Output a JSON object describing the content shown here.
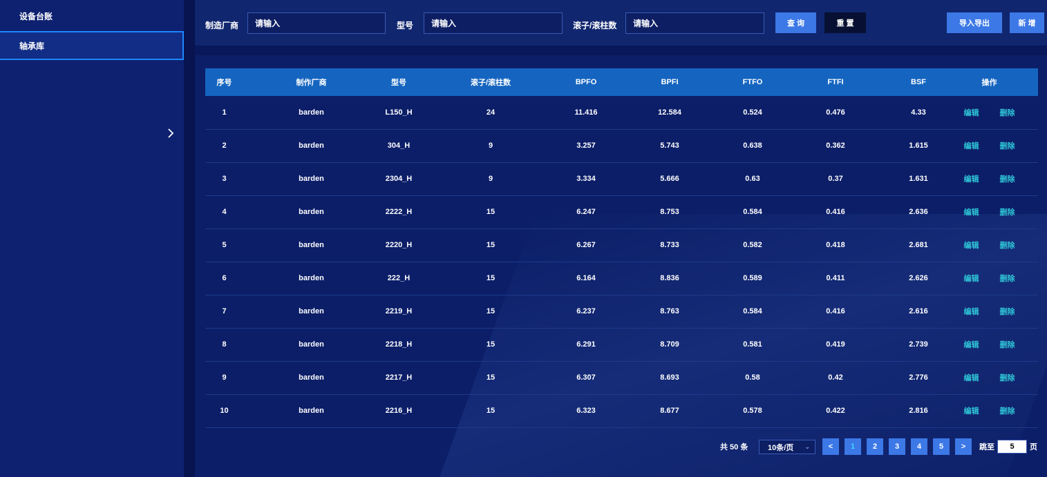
{
  "sidebar": {
    "items": [
      {
        "label": "设备台账"
      },
      {
        "label": "轴承库"
      }
    ]
  },
  "filters": {
    "manufacturer_label": "制造厂商",
    "manufacturer_placeholder": "请输入",
    "model_label": "型号",
    "model_placeholder": "请输入",
    "rollers_label": "滚子/滚柱数",
    "rollers_placeholder": "请输入",
    "query_label": "查 询",
    "reset_label": "重 置",
    "import_export_label": "导入导出",
    "add_label": "新 增"
  },
  "table": {
    "columns": [
      "序号",
      "制作厂商",
      "型号",
      "滚子/滚柱数",
      "BPFO",
      "BPFI",
      "FTFO",
      "FTFI",
      "BSF",
      "操作"
    ],
    "edit_label": "编辑",
    "delete_label": "删除",
    "rows": [
      [
        "1",
        "barden",
        "L150_H",
        "24",
        "11.416",
        "12.584",
        "0.524",
        "0.476",
        "4.33"
      ],
      [
        "2",
        "barden",
        "304_H",
        "9",
        "3.257",
        "5.743",
        "0.638",
        "0.362",
        "1.615"
      ],
      [
        "3",
        "barden",
        "2304_H",
        "9",
        "3.334",
        "5.666",
        "0.63",
        "0.37",
        "1.631"
      ],
      [
        "4",
        "barden",
        "2222_H",
        "15",
        "6.247",
        "8.753",
        "0.584",
        "0.416",
        "2.636"
      ],
      [
        "5",
        "barden",
        "2220_H",
        "15",
        "6.267",
        "8.733",
        "0.582",
        "0.418",
        "2.681"
      ],
      [
        "6",
        "barden",
        "222_H",
        "15",
        "6.164",
        "8.836",
        "0.589",
        "0.411",
        "2.626"
      ],
      [
        "7",
        "barden",
        "2219_H",
        "15",
        "6.237",
        "8.763",
        "0.584",
        "0.416",
        "2.616"
      ],
      [
        "8",
        "barden",
        "2218_H",
        "15",
        "6.291",
        "8.709",
        "0.581",
        "0.419",
        "2.739"
      ],
      [
        "9",
        "barden",
        "2217_H",
        "15",
        "6.307",
        "8.693",
        "0.58",
        "0.42",
        "2.776"
      ],
      [
        "10",
        "barden",
        "2216_H",
        "15",
        "6.323",
        "8.677",
        "0.578",
        "0.422",
        "2.816"
      ]
    ]
  },
  "pagination": {
    "total": "共 50 条",
    "page_size": "10条/页",
    "prev": "<",
    "next": ">",
    "pages": [
      "1",
      "2",
      "3",
      "4",
      "5"
    ],
    "current": "1",
    "jump_label": "跳至",
    "jump_value": "5",
    "page_unit": "页"
  },
  "colors": {
    "accent": "#3c78e6",
    "header": "#1565c0",
    "link": "#2fc6d8"
  }
}
